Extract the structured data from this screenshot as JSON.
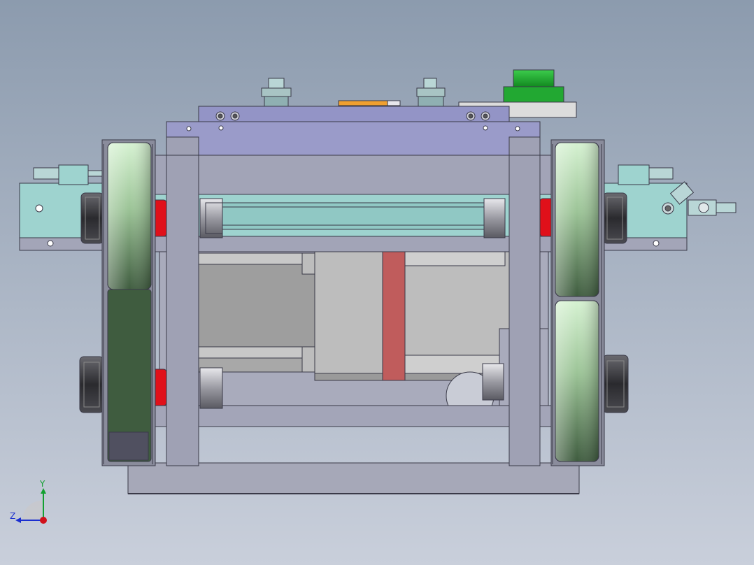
{
  "viewport": {
    "background_top": "#8c9bae",
    "background_bottom": "#c9cfdb"
  },
  "colors": {
    "frame_purple": "#9a9bc9",
    "frame_grey": "#9fa1b4",
    "teal": "#9ed3cf",
    "wheel_green_light": "#cfeecc",
    "wheel_green_dark": "#3f5c3f",
    "motor_grey": "#bdbdbd",
    "motor_stripe": "#c05c5c",
    "seal_red": "#e0101a",
    "knob_green": "#22a832",
    "bearing_dark": "#2f2f33",
    "edge": "#3a3a48",
    "strip_orange": "#f0a030"
  },
  "triad": {
    "x_color": "#d0101a",
    "y_color": "#12a030",
    "z_color": "#1a2ed0",
    "y_label": "Y",
    "z_label": "Z"
  }
}
